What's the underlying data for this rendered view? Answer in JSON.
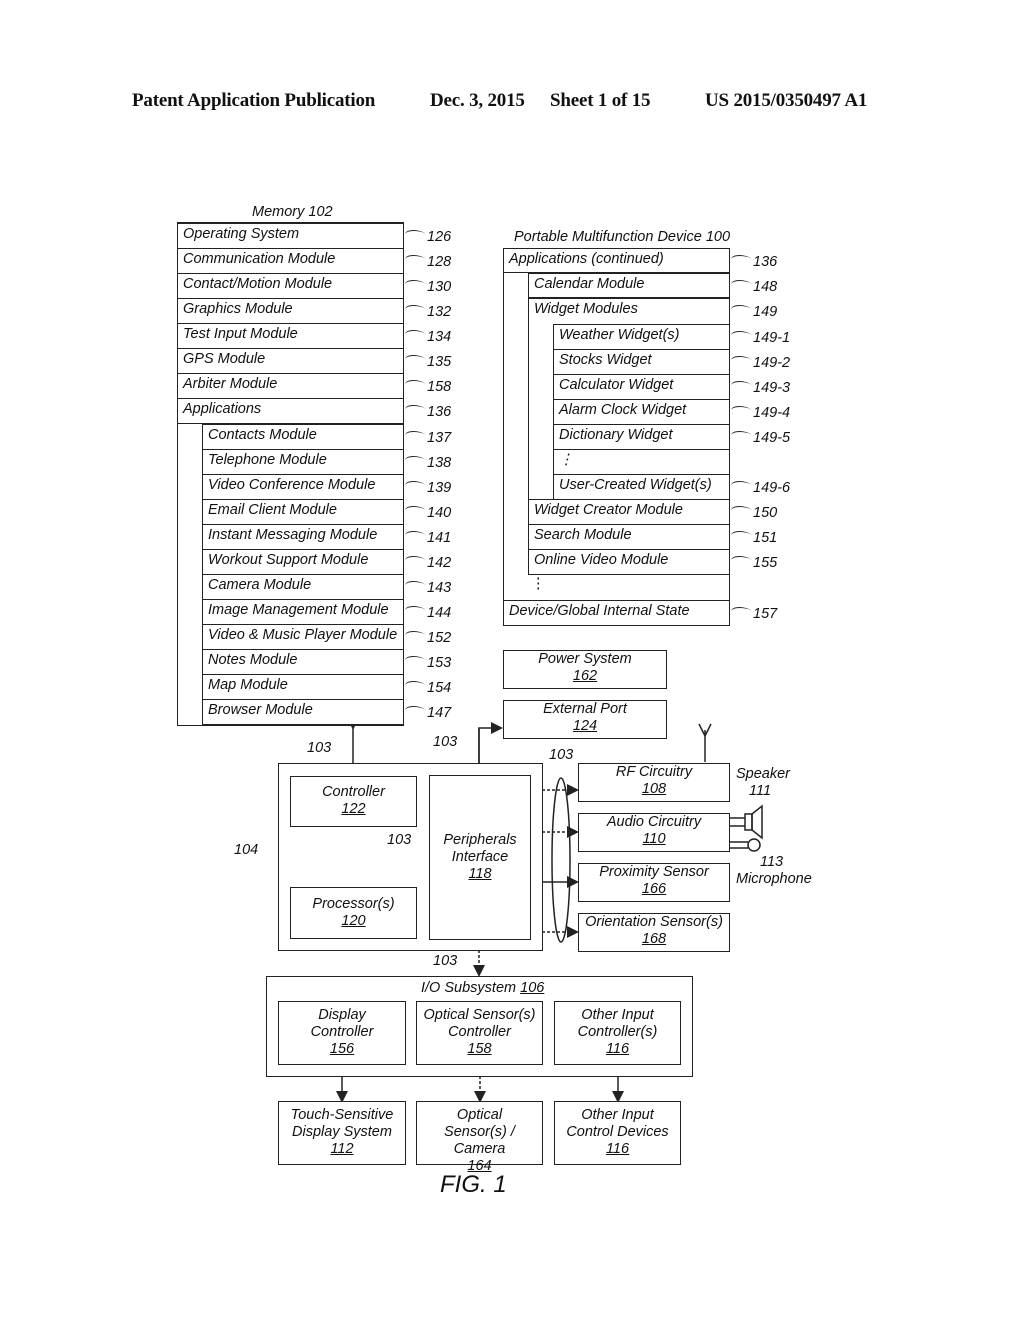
{
  "header": {
    "publication": "Patent Application Publication",
    "date": "Dec. 3, 2015",
    "sheet": "Sheet 1 of 15",
    "number": "US 2015/0350497 A1"
  },
  "memory": {
    "title": "Memory 102",
    "rows": [
      {
        "label": "Operating System",
        "ref": "126"
      },
      {
        "label": "Communication Module",
        "ref": "128"
      },
      {
        "label": "Contact/Motion Module",
        "ref": "130"
      },
      {
        "label": "Graphics Module",
        "ref": "132"
      },
      {
        "label": "Test Input Module",
        "ref": "134"
      },
      {
        "label": "GPS Module",
        "ref": "135"
      },
      {
        "label": "Arbiter Module",
        "ref": "158"
      },
      {
        "label": "Applications",
        "ref": "136"
      }
    ],
    "apps": [
      {
        "label": "Contacts Module",
        "ref": "137"
      },
      {
        "label": "Telephone Module",
        "ref": "138"
      },
      {
        "label": "Video Conference Module",
        "ref": "139"
      },
      {
        "label": "Email Client Module",
        "ref": "140"
      },
      {
        "label": "Instant Messaging Module",
        "ref": "141"
      },
      {
        "label": "Workout Support Module",
        "ref": "142"
      },
      {
        "label": "Camera Module",
        "ref": "143"
      },
      {
        "label": "Image Management Module",
        "ref": "144"
      },
      {
        "label": "Video & Music Player Module",
        "ref": "152"
      },
      {
        "label": "Notes Module",
        "ref": "153"
      },
      {
        "label": "Map Module",
        "ref": "154"
      },
      {
        "label": "Browser Module",
        "ref": "147"
      }
    ]
  },
  "device": {
    "title": "Portable Multifunction Device 100",
    "apps_continued": {
      "label": "Applications (continued)",
      "ref": "136"
    },
    "calendar": {
      "label": "Calendar Module",
      "ref": "148"
    },
    "widget_modules": {
      "label": "Widget Modules",
      "ref": "149"
    },
    "widgets": [
      {
        "label": "Weather Widget(s)",
        "ref": "149-1"
      },
      {
        "label": "Stocks Widget",
        "ref": "149-2"
      },
      {
        "label": "Calculator Widget",
        "ref": "149-3"
      },
      {
        "label": "Alarm Clock Widget",
        "ref": "149-4"
      },
      {
        "label": "Dictionary Widget",
        "ref": "149-5"
      },
      {
        "label": "⋮",
        "ref": ""
      },
      {
        "label": "User-Created Widget(s)",
        "ref": "149-6"
      }
    ],
    "more_modules": [
      {
        "label": "Widget Creator Module",
        "ref": "150"
      },
      {
        "label": "Search Module",
        "ref": "151"
      },
      {
        "label": "Online Video Module",
        "ref": "155"
      }
    ],
    "ellipsis": "⋮",
    "state": {
      "label": "Device/Global Internal State",
      "ref": "157"
    }
  },
  "blocks": {
    "power": {
      "label": "Power System",
      "num": "162"
    },
    "port": {
      "label": "External Port",
      "num": "124"
    },
    "controller": {
      "label": "Controller",
      "num": "122"
    },
    "processor": {
      "label": "Processor(s)",
      "num": "120"
    },
    "peripherals": {
      "label1": "Peripherals",
      "label2": "Interface",
      "num": "118"
    },
    "rf": {
      "label": "RF Circuitry",
      "num": "108"
    },
    "audio": {
      "label": "Audio Circuitry",
      "num": "110"
    },
    "proximity": {
      "label": "Proximity Sensor",
      "num": "166"
    },
    "orientation": {
      "label": "Orientation Sensor(s)",
      "num": "168"
    },
    "io": {
      "label": "I/O Subsystem",
      "num": "106"
    },
    "display_ctrl": {
      "label1": "Display",
      "label2": "Controller",
      "num": "156"
    },
    "optical_ctrl": {
      "label1": "Optical Sensor(s)",
      "label2": "Controller",
      "num": "158"
    },
    "other_ctrl": {
      "label1": "Other Input",
      "label2": "Controller(s)",
      "num": "116"
    },
    "touch": {
      "label1": "Touch-Sensitive",
      "label2": "Display System",
      "num": "112"
    },
    "optical": {
      "label1": "Optical",
      "label2": "Sensor(s) / Camera",
      "num": "164"
    },
    "other_dev": {
      "label1": "Other Input",
      "label2": "Control Devices",
      "num": "116"
    }
  },
  "labels": {
    "bus": "103",
    "chip": "104",
    "speaker": "Speaker",
    "speaker_num": "111",
    "mic": "Microphone",
    "mic_num": "113"
  },
  "figure": "FIG. 1"
}
